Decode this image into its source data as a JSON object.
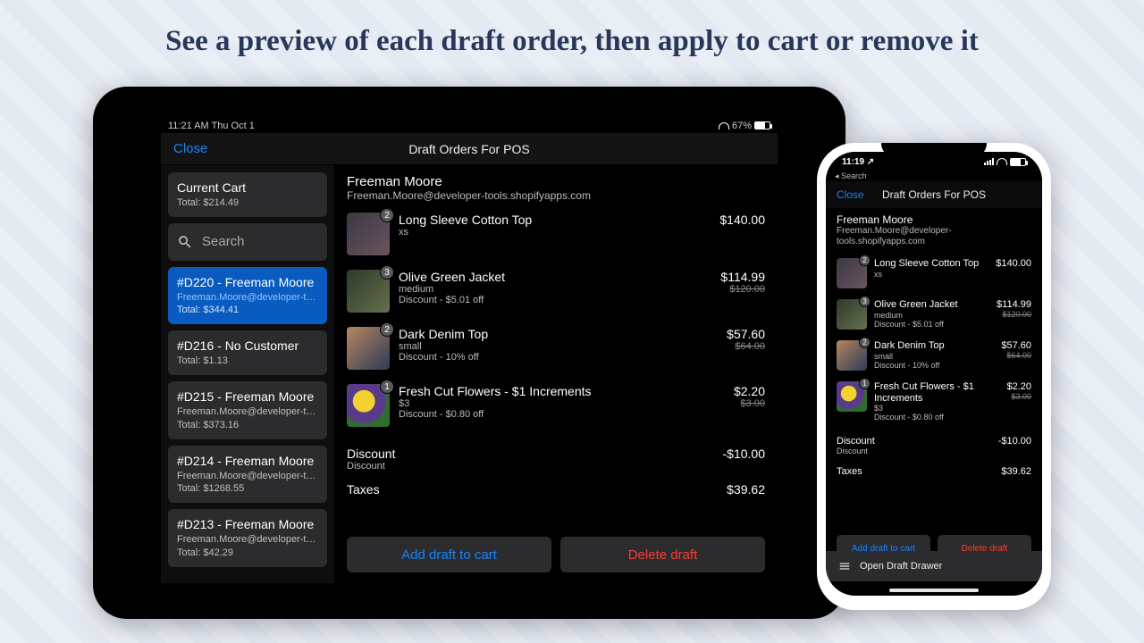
{
  "heading": "See a preview of each draft order, then apply to cart or remove it",
  "ipad": {
    "status_left": "11:21 AM   Thu Oct 1",
    "status_right": "67%",
    "close": "Close",
    "title": "Draft Orders For POS",
    "sidebar": {
      "current_cart_label": "Current Cart",
      "current_cart_total": "Total: $214.49",
      "search_placeholder": "Search",
      "drafts": [
        {
          "title": "#D220 - Freeman Moore",
          "email": "Freeman.Moore@developer-t…",
          "total": "Total: $344.41",
          "selected": true
        },
        {
          "title": "#D216 - No Customer",
          "email": "",
          "total": "Total: $1.13",
          "selected": false
        },
        {
          "title": "#D215 - Freeman Moore",
          "email": "Freeman.Moore@developer-t…",
          "total": "Total: $373.16",
          "selected": false
        },
        {
          "title": "#D214 - Freeman Moore",
          "email": "Freeman.Moore@developer-t…",
          "total": "Total: $1268.55",
          "selected": false
        },
        {
          "title": "#D213 - Freeman Moore",
          "email": "Freeman.Moore@developer-t…",
          "total": "Total: $42.29",
          "selected": false
        }
      ]
    },
    "customer": {
      "name": "Freeman Moore",
      "email": "Freeman.Moore@developer-tools.shopifyapps.com"
    },
    "items": [
      {
        "qty": "2",
        "name": "Long Sleeve Cotton Top",
        "variant": "xs",
        "discount": "",
        "price": "$140.00",
        "was": "",
        "swatch": "linear-gradient(135deg,#3b3842,#6a5560)"
      },
      {
        "qty": "3",
        "name": "Olive Green Jacket",
        "variant": "medium",
        "discount": "Discount - $5.01 off",
        "price": "$114.99",
        "was": "$120.00",
        "swatch": "linear-gradient(135deg,#2e3a2a,#67704f)"
      },
      {
        "qty": "2",
        "name": "Dark Denim Top",
        "variant": "small",
        "discount": "Discount - 10% off",
        "price": "$57.60",
        "was": "$64.00",
        "swatch": "linear-gradient(135deg,#b88660,#2c3b55)"
      },
      {
        "qty": "1",
        "name": "Fresh Cut Flowers - $1 Increments",
        "variant": "$3",
        "discount": "Discount - $0.80 off",
        "price": "$2.20",
        "was": "$3.00",
        "swatch": "radial-gradient(circle at 40% 40%, #f2d22e 0 30%, #5a3b8a 31% 60%, #2f6d2f 61%)"
      }
    ],
    "discount": {
      "label": "Discount",
      "sub": "Discount",
      "value": "-$10.00"
    },
    "taxes": {
      "label": "Taxes",
      "value": "$39.62"
    },
    "actions": {
      "add": "Add draft to cart",
      "del": "Delete draft"
    }
  },
  "iphone": {
    "status_time": "11:19",
    "back": "◂ Search",
    "close": "Close",
    "title": "Draft Orders For POS",
    "customer": {
      "name": "Freeman Moore",
      "email": "Freeman.Moore@developer-tools.shopifyapps.com"
    },
    "items": [
      {
        "qty": "2",
        "name": "Long Sleeve Cotton Top",
        "variant": "xs",
        "discount": "",
        "price": "$140.00",
        "was": "",
        "swatch": "linear-gradient(135deg,#3b3842,#6a5560)"
      },
      {
        "qty": "3",
        "name": "Olive Green Jacket",
        "variant": "medium",
        "discount": "Discount - $5.01 off",
        "price": "$114.99",
        "was": "$120.00",
        "swatch": "linear-gradient(135deg,#2e3a2a,#67704f)"
      },
      {
        "qty": "2",
        "name": "Dark Denim Top",
        "variant": "small",
        "discount": "Discount - 10% off",
        "price": "$57.60",
        "was": "$64.00",
        "swatch": "linear-gradient(135deg,#b88660,#2c3b55)"
      },
      {
        "qty": "1",
        "name": "Fresh Cut Flowers - $1 Increments",
        "variant": "$3",
        "discount": "Discount - $0.80 off",
        "price": "$2.20",
        "was": "$3.00",
        "swatch": "radial-gradient(circle at 40% 40%, #f2d22e 0 30%, #5a3b8a 31% 60%, #2f6d2f 61%)"
      }
    ],
    "discount": {
      "label": "Discount",
      "sub": "Discount",
      "value": "-$10.00"
    },
    "taxes": {
      "label": "Taxes",
      "value": "$39.62"
    },
    "actions": {
      "add": "Add draft to cart",
      "del": "Delete draft"
    },
    "drawer": "Open Draft Drawer"
  }
}
